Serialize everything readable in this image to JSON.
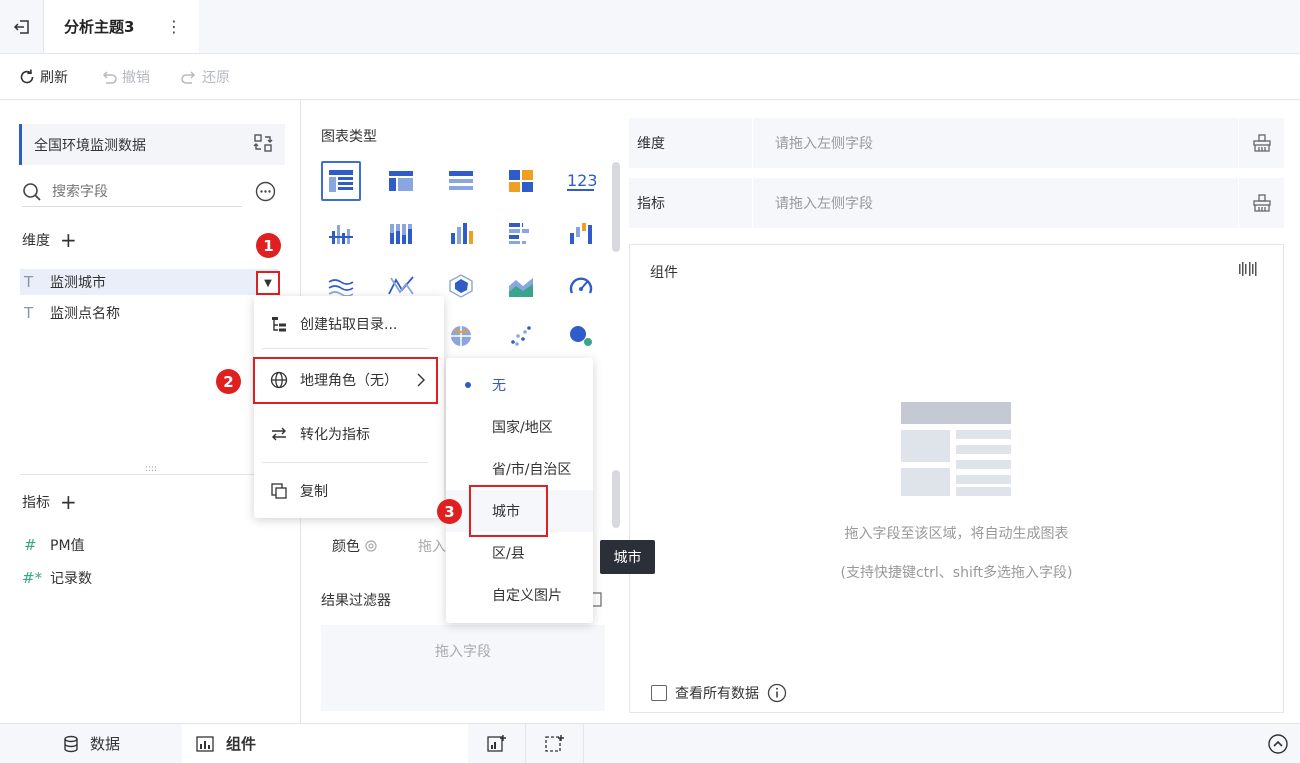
{
  "topbar": {
    "tab_title": "分析主题3",
    "more": "⋮"
  },
  "toolbar": {
    "refresh": "刷新",
    "undo": "撤销",
    "redo": "还原"
  },
  "left": {
    "dataset": "全国环境监测数据",
    "search_placeholder": "搜索字段",
    "dimensions_label": "维度",
    "dimensions": [
      {
        "icon": "T",
        "name": "监测城市"
      },
      {
        "icon": "T",
        "name": "监测点名称"
      }
    ],
    "measures_label": "指标",
    "measures": [
      {
        "icon": "#",
        "name": "PM值"
      },
      {
        "icon": "#*",
        "name": "记录数"
      }
    ],
    "dropdown_arrow": "▼"
  },
  "middle": {
    "chart_type_label": "图表类型",
    "color_label": "颜色",
    "color_drop": "拖入",
    "filter_label": "结果过滤器",
    "filter_drop": "拖入字段"
  },
  "right": {
    "dimension_label": "维度",
    "dimension_placeholder": "请拖入左侧字段",
    "measure_label": "指标",
    "measure_placeholder": "请拖入左侧字段",
    "component_label": "组件",
    "empty_text1": "拖入字段至该区域，将自动生成图表",
    "empty_text2": "(支持快捷键ctrl、shift多选拖入字段)",
    "view_all": "查看所有数据"
  },
  "context_menu": {
    "drill": "创建钻取目录...",
    "geo_role": "地理角色（无）",
    "to_measure": "转化为指标",
    "copy": "复制"
  },
  "submenu": {
    "none": "无",
    "country": "国家/地区",
    "province": "省/市/自治区",
    "city": "城市",
    "district": "区/县",
    "custom": "自定义图片"
  },
  "tooltip": "城市",
  "badges": [
    "1",
    "2",
    "3"
  ],
  "bottombar": {
    "data_tab": "数据",
    "component_tab": "组件"
  },
  "colors": {
    "accent": "#2f5cc9",
    "highlight": "#e02020",
    "panel_bg": "#f5f7fb"
  }
}
